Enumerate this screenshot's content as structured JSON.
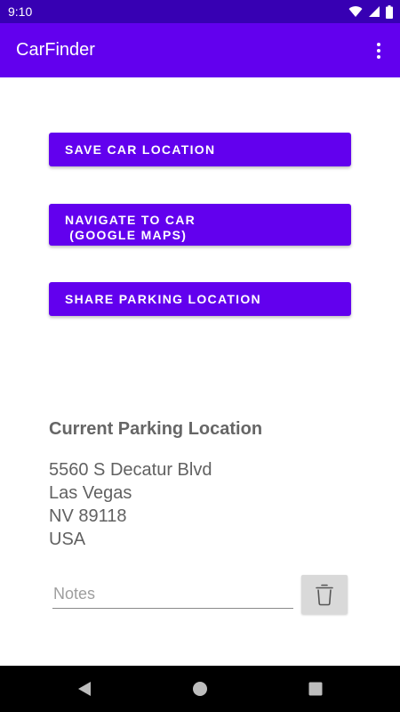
{
  "status_bar": {
    "time": "9:10",
    "icons": [
      "wifi-icon",
      "signal-icon",
      "battery-icon"
    ],
    "background": "#3700b3"
  },
  "app_bar": {
    "title": "CarFinder",
    "menu_icon": "more-vert-icon",
    "background": "#6200ee"
  },
  "buttons": {
    "save_label": "SAVE CAR LOCATION",
    "navigate_label": "NAVIGATE TO CAR\n (GOOGLE MAPS)",
    "share_label": "SHARE PARKING LOCATION",
    "color": "#6200ee"
  },
  "location": {
    "heading": "Current Parking Location",
    "lines": [
      "5560 S Decatur Blvd",
      "Las Vegas",
      "NV 89118",
      "USA"
    ]
  },
  "notes": {
    "placeholder": "Notes",
    "value": ""
  },
  "delete_icon": "trash-icon",
  "nav_bar": {
    "buttons": [
      "back-icon",
      "home-icon",
      "recents-icon"
    ]
  }
}
